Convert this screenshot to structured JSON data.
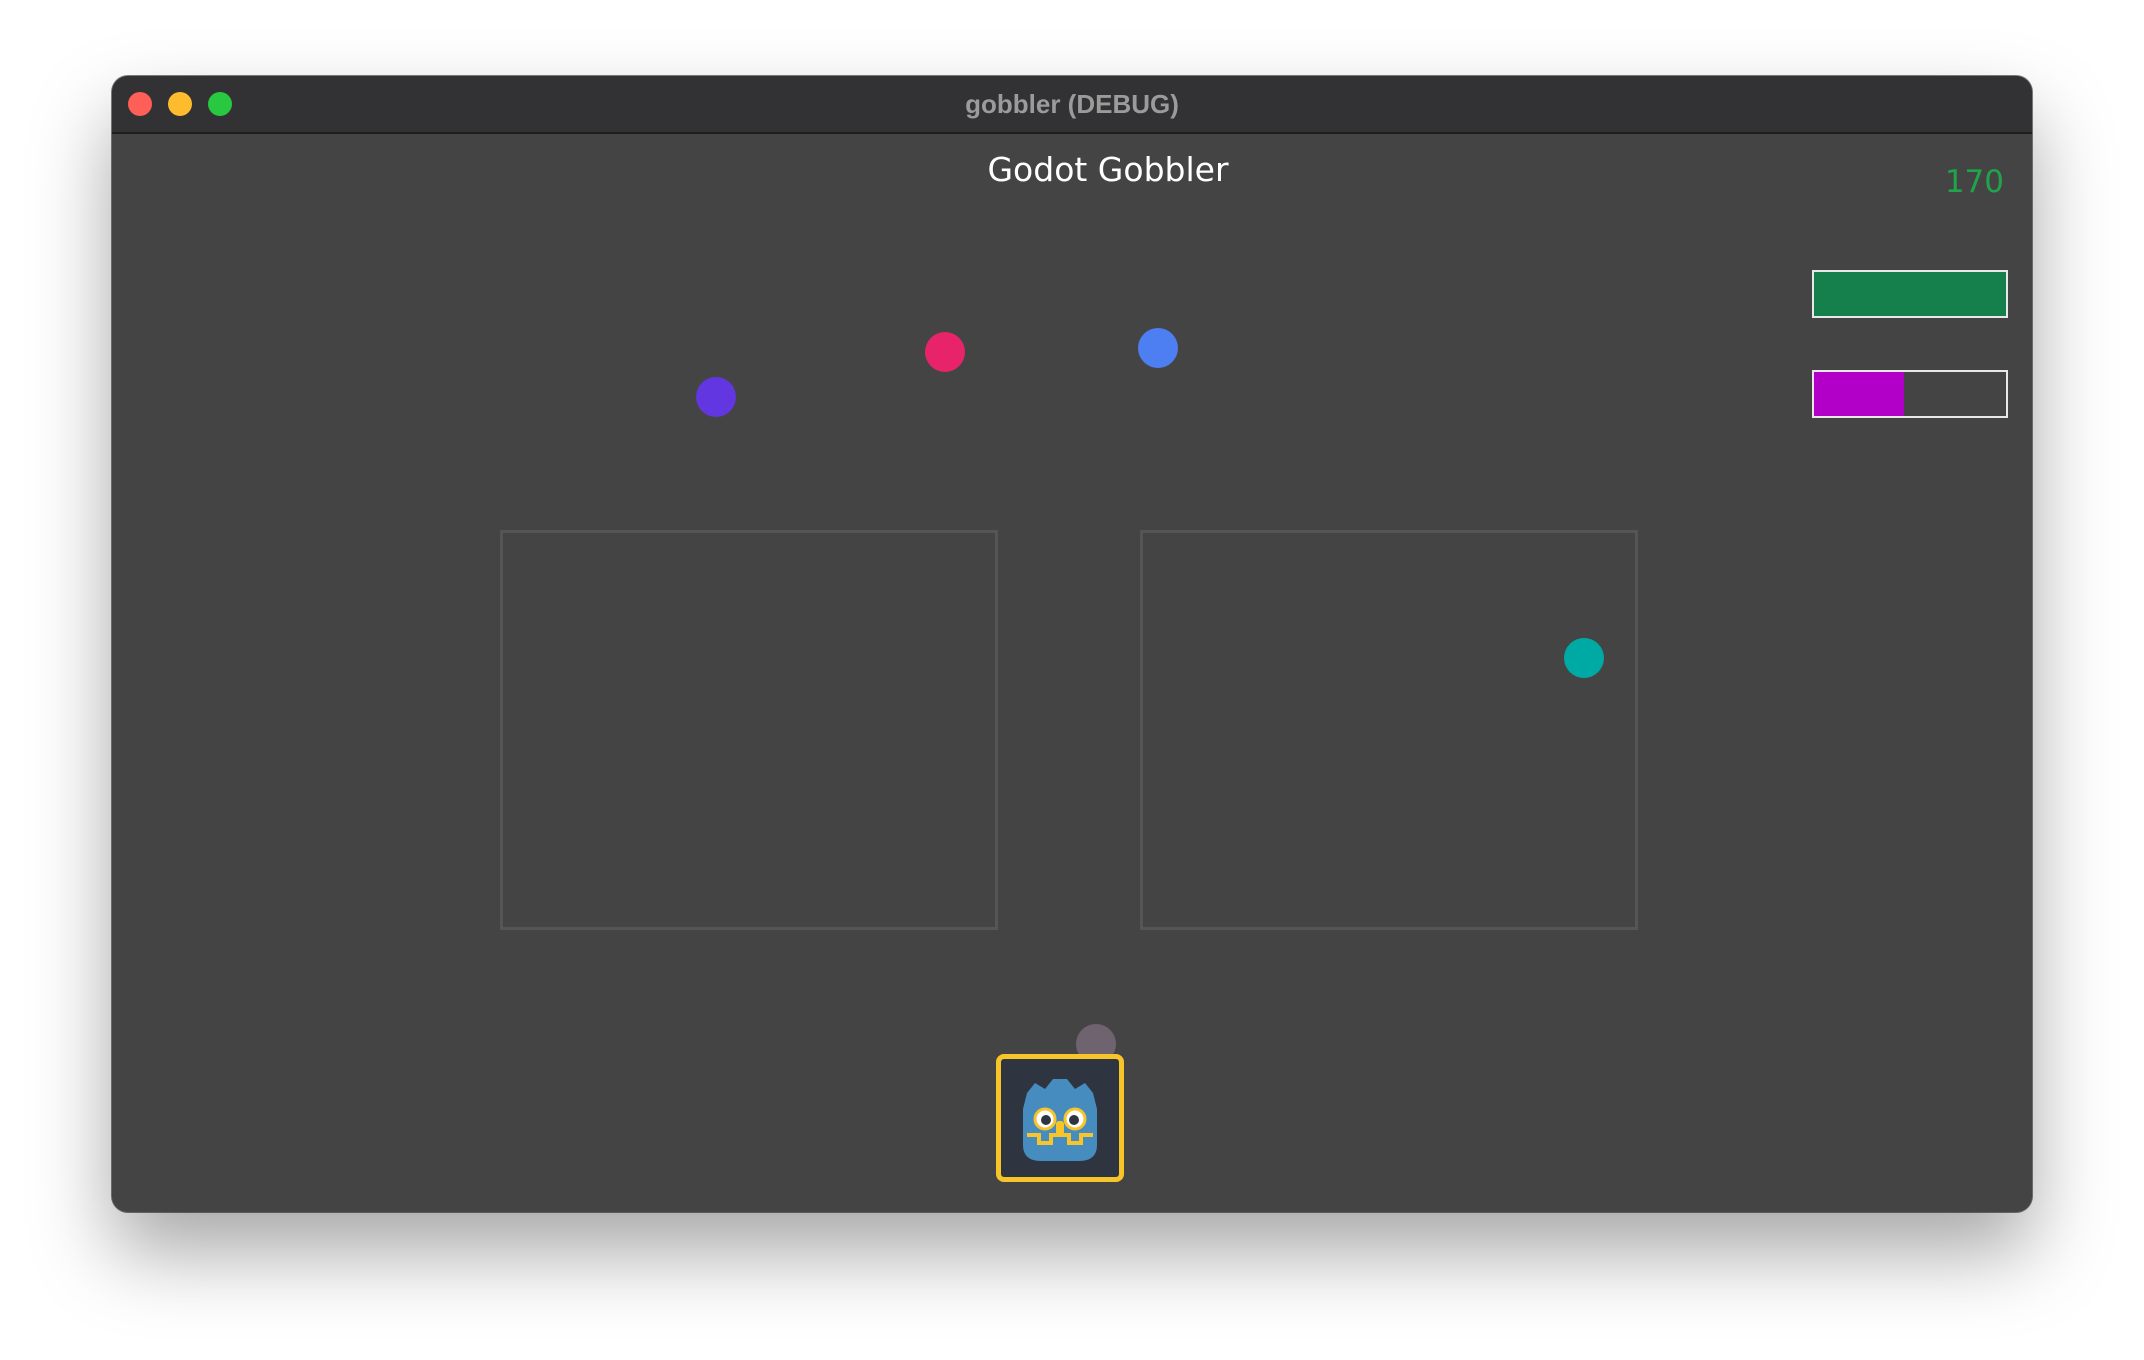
{
  "window": {
    "title": "gobbler (DEBUG)"
  },
  "hud": {
    "game_title": "Godot Gobbler",
    "score": "170",
    "bars": [
      {
        "name": "green-bar",
        "fraction": 1.0,
        "color": "#16804d"
      },
      {
        "name": "magenta-bar",
        "fraction": 0.47,
        "color": "#b300c9"
      }
    ]
  },
  "colors": {
    "background": "#444444",
    "titlebar": "#323134",
    "score": "#1fa44a",
    "zone_border": "#555555",
    "player_border": "#f7c52a"
  },
  "collectibles": [
    {
      "name": "purple-orb",
      "color": "#6236e0"
    },
    {
      "name": "pink-orb",
      "color": "#e7246a"
    },
    {
      "name": "blue-orb",
      "color": "#4d7ef2"
    },
    {
      "name": "teal-orb",
      "color": "#00aaa4"
    },
    {
      "name": "gray-orb",
      "color": "#6f6370"
    }
  ],
  "player": {
    "icon": "godot-robot-icon"
  }
}
